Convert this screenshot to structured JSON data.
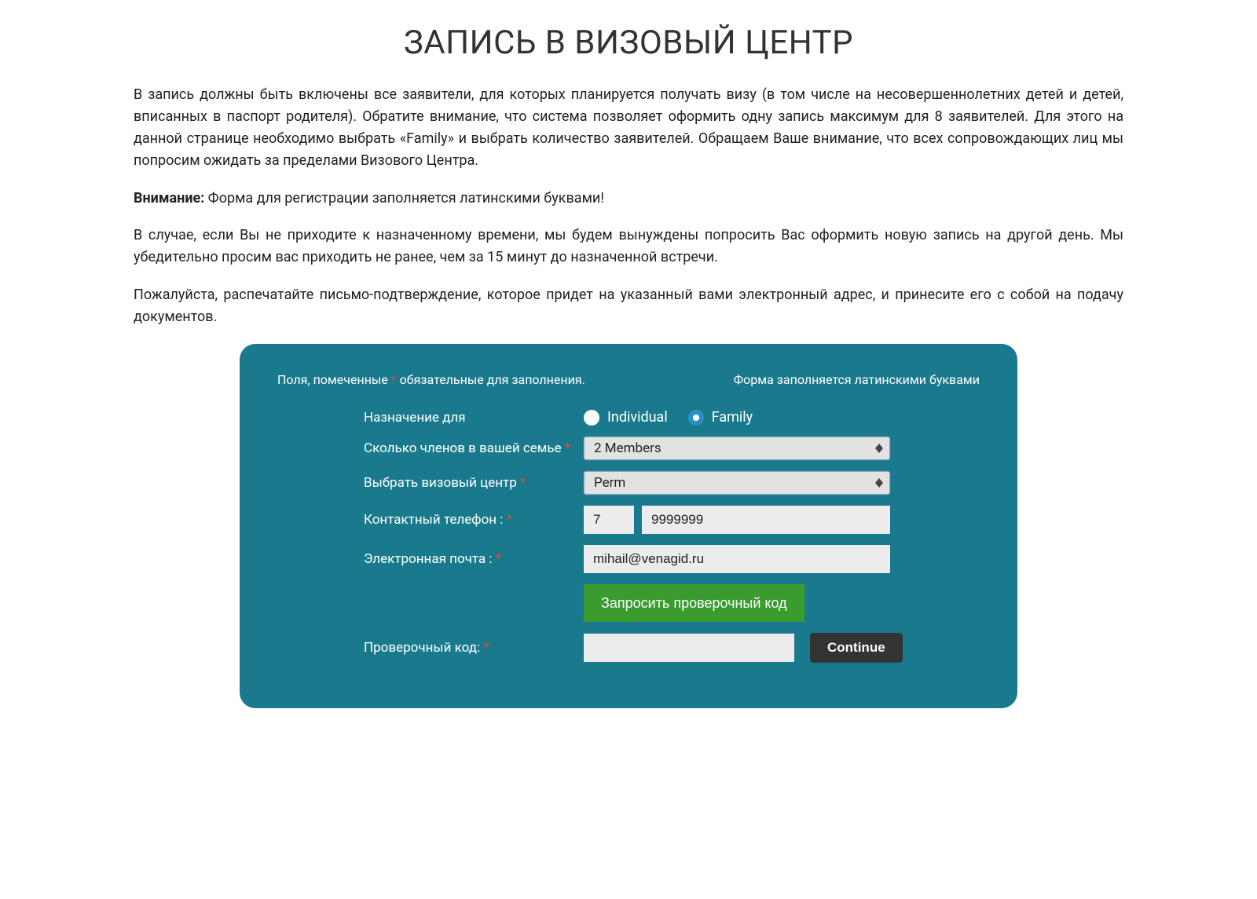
{
  "page": {
    "title": "ЗАПИСЬ В ВИЗОВЫЙ ЦЕНТР",
    "para1": "В запись должны быть включены все заявители, для которых планируется получать визу (в том числе на несовершеннолетних детей и детей, вписанных в паспорт родителя). Обратите внимание, что система позволяет оформить одну запись максимум для 8 заявителей. Для этого на данной странице необходимо выбрать «Family» и выбрать количество заявителей. Обращаем Ваше внимание, что всех сопровождающих лиц мы попросим ожидать за пределами Визового Центра.",
    "attention_label": "Внимание:",
    "attention_text": " Форма для регистрации заполняется латинскими буквами!",
    "para3": "В случае, если Вы не приходите к назначенному времени, мы будем вынуждены попросить Вас оформить новую запись на другой день. Мы убедительно просим вас приходить не ранее, чем за 15 минут до назначенной встречи.",
    "para4": "Пожалуйста, распечатайте письмо-подтверждение, которое придет на указанный вами электронный адрес, и принесите его с собой на подачу документов."
  },
  "form": {
    "required_note_pre": "Поля, помеченные ",
    "required_note_post": " обязательные для заполнения.",
    "asterisk": "*",
    "latin_note": "Форма заполняется латинскими буквами",
    "labels": {
      "appointment_for": "Назначение для",
      "members": "Сколько членов в вашей семье ",
      "center": "Выбрать визовый центр ",
      "phone": "Контактный телефон : ",
      "email": "Электронная почта : ",
      "code": "Проверочный код: "
    },
    "radio": {
      "individual": "Individual",
      "family": "Family",
      "selected": "family"
    },
    "members_value": "2 Members",
    "center_value": "Perm",
    "phone_cc": "7",
    "phone_number": "9999999",
    "email_value": "mihail@venagid.ru",
    "request_code_btn": "Запросить проверочный код",
    "code_value": "",
    "continue_btn": "Continue"
  }
}
